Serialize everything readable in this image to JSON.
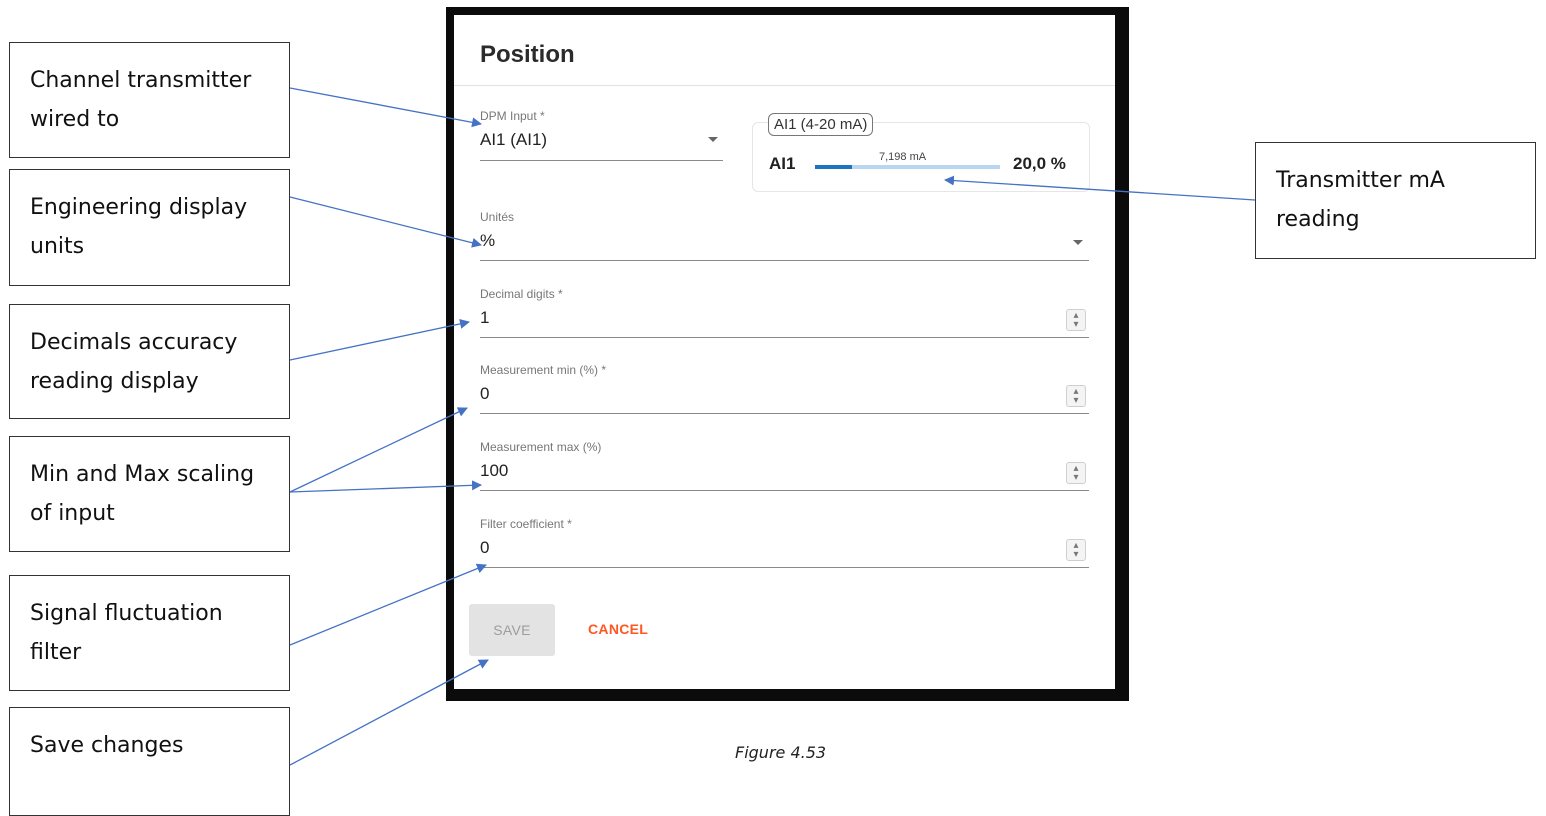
{
  "callouts": {
    "channel": "Channel transmitter wired to",
    "units": "Engineering display units",
    "decimals": "Decimals accuracy reading display",
    "minmax": "Min and Max scaling of input",
    "filter": "Signal fluctuation filter",
    "save": "Save changes",
    "transmitter": "Transmitter mA reading"
  },
  "dialog": {
    "title": "Position",
    "dpm_input": {
      "label": "DPM Input *",
      "value": "AI1 (AI1)"
    },
    "ai_card": {
      "chip": "AI1 (4-20 mA)",
      "name": "AI1",
      "ma": "7,198 mA",
      "percent": "20,0 %",
      "level": 0.2
    },
    "units": {
      "label": "Unités",
      "value": "%"
    },
    "decimal_digits": {
      "label": "Decimal digits *",
      "value": "1"
    },
    "measurement_min": {
      "label": "Measurement min (%) *",
      "value": "0"
    },
    "measurement_max": {
      "label": "Measurement max (%)",
      "value": "100"
    },
    "filter_coefficient": {
      "label": "Filter coefficient *",
      "value": "0"
    },
    "save_label": "SAVE",
    "cancel_label": "CANCEL"
  },
  "figure_caption": "Figure 4.53",
  "colors": {
    "accent_bar": "#1e73be",
    "accent_bar_track": "#b8d6ef",
    "cancel": "#ff5722",
    "arrow": "#4472c4"
  }
}
